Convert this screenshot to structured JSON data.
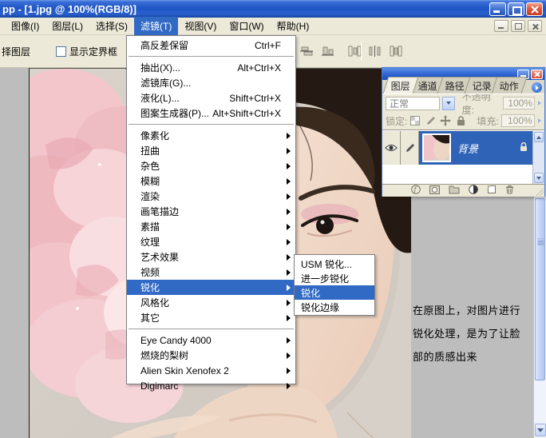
{
  "window": {
    "title": "pp - [1.jpg @ 100%(RGB/8)]"
  },
  "menubar": {
    "items": [
      {
        "label": "图像(I)"
      },
      {
        "label": "图层(L)"
      },
      {
        "label": "选择(S)"
      },
      {
        "label": "滤镜(T)",
        "active": true
      },
      {
        "label": "视图(V)"
      },
      {
        "label": "窗口(W)"
      },
      {
        "label": "帮助(H)"
      }
    ]
  },
  "options_bar": {
    "auto_select_label": "择图层",
    "show_bounds_label": "显示定界框",
    "show_bounds_checked": false
  },
  "filter_menu": {
    "items": [
      {
        "label": "高反差保留",
        "shortcut": "Ctrl+F"
      },
      {
        "label": "抽出(X)...",
        "shortcut": "Alt+Ctrl+X"
      },
      {
        "label": "滤镜库(G)...",
        "shortcut": ""
      },
      {
        "label": "液化(L)...",
        "shortcut": "Shift+Ctrl+X"
      },
      {
        "label": "图案生成器(P)...",
        "shortcut": "Alt+Shift+Ctrl+X"
      },
      {
        "label": "像素化"
      },
      {
        "label": "扭曲"
      },
      {
        "label": "杂色"
      },
      {
        "label": "模糊"
      },
      {
        "label": "渲染"
      },
      {
        "label": "画笔描边"
      },
      {
        "label": "素描"
      },
      {
        "label": "纹理"
      },
      {
        "label": "艺术效果"
      },
      {
        "label": "视频"
      },
      {
        "label": "锐化",
        "selected": true
      },
      {
        "label": "风格化"
      },
      {
        "label": "其它"
      },
      {
        "label": "Eye Candy 4000"
      },
      {
        "label": "燃烧的梨树"
      },
      {
        "label": "Alien Skin Xenofex 2"
      },
      {
        "label": "Digimarc"
      }
    ]
  },
  "sharpen_submenu": {
    "items": [
      {
        "label": "USM 锐化..."
      },
      {
        "label": "进一步锐化"
      },
      {
        "label": "锐化",
        "selected": true
      },
      {
        "label": "锐化边缘"
      }
    ]
  },
  "layers_palette": {
    "tabs": [
      {
        "label": "图层",
        "active": true
      },
      {
        "label": "通道"
      },
      {
        "label": "路径"
      },
      {
        "label": "记录"
      },
      {
        "label": "动作"
      }
    ],
    "blend_mode": "正常",
    "opacity_label": "不透明度:",
    "opacity_value": "100%",
    "lock_label": "锁定:",
    "fill_label": "填充:",
    "fill_value": "100%",
    "layer": {
      "name": "背景",
      "locked": true
    }
  },
  "annotation": {
    "lines": [
      "在原图上，对图片进行",
      "锐化处理，是为了让脸",
      "部的质感出来"
    ]
  },
  "colors": {
    "menu_highlight": "#316ac5",
    "titlebar_blue": "#2a60cc",
    "workspace_gray": "#bdbdbd",
    "layer_selection": "#2e63b8"
  }
}
